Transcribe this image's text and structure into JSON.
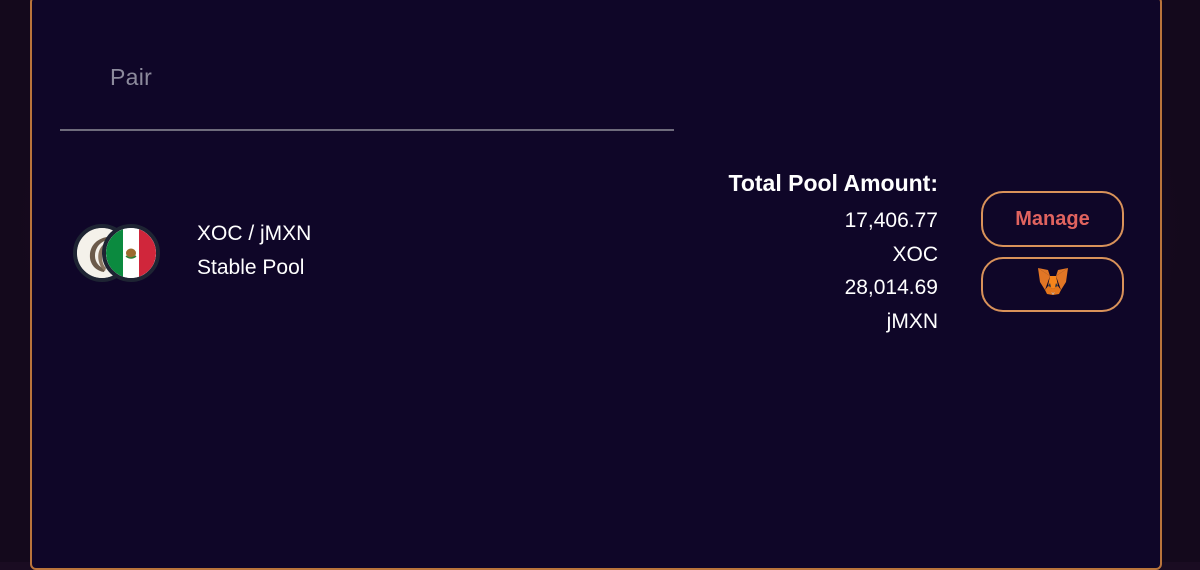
{
  "table": {
    "header": {
      "pair_label": "Pair"
    }
  },
  "pool": {
    "tokens": [
      {
        "symbol": "XOC",
        "icon": "xoc-token-icon"
      },
      {
        "symbol": "jMXN",
        "icon": "mexico-flag-icon"
      }
    ],
    "pair_name": "XOC / jMXN",
    "pool_type": "Stable Pool",
    "total_label": "Total Pool Amount:",
    "amount_a": "17,406.77",
    "symbol_a": "XOC",
    "amount_b": "28,014.69",
    "symbol_b": "jMXN"
  },
  "actions": {
    "manage_label": "Manage",
    "metamask_icon": "metamask-fox-icon"
  },
  "colors": {
    "background": "#0f0628",
    "accent_border": "#d9925a",
    "manage_text": "#e0635f"
  }
}
